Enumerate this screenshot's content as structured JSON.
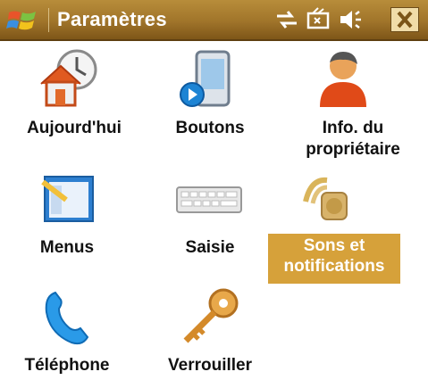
{
  "titlebar": {
    "title": "Paramètres",
    "accent_color": "#a0742a",
    "icons": [
      "windows-flag-icon",
      "network-sync-icon",
      "battery-icon",
      "volume-icon",
      "close-icon"
    ],
    "close_label": "✕"
  },
  "items": [
    {
      "label": "Aujourd'hui",
      "icon": "home-clock-icon"
    },
    {
      "label": "Boutons",
      "icon": "phone-button-icon"
    },
    {
      "label_line1": "Info. du",
      "label_line2": "propriétaire",
      "icon": "owner-person-icon"
    },
    {
      "label": "Menus",
      "icon": "menu-window-icon"
    },
    {
      "label": "Saisie",
      "icon": "keyboard-icon"
    },
    {
      "label_line1": "Sons et",
      "label_line2": "notifications",
      "icon": "speaker-icon",
      "selected": true,
      "selected_color": "#d6a13a"
    },
    {
      "label": "Téléphone",
      "icon": "telephone-icon"
    },
    {
      "label": "Verrouiller",
      "icon": "key-icon"
    }
  ]
}
